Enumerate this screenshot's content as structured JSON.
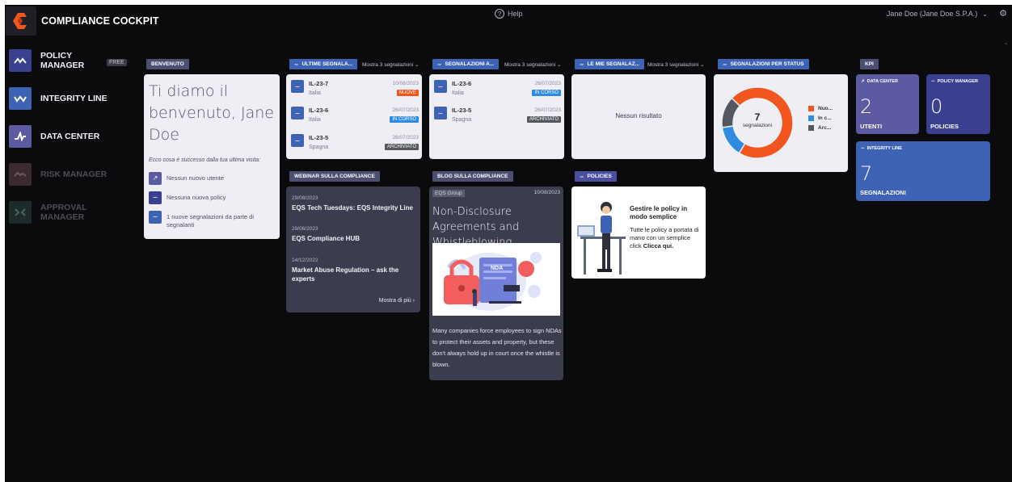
{
  "header": {
    "app_title": "COMPLIANCE COCKPIT",
    "help_label": "Help",
    "user_label": "Jane Doe (Jane Doe S.P.A.)"
  },
  "sidebar": {
    "items": [
      {
        "label_line1": "POLICY",
        "label_line2": "MANAGER",
        "badge": "FREE",
        "color": "#3b3f8f",
        "disabled": false
      },
      {
        "label_line1": "INTEGRITY LINE",
        "label_line2": "",
        "color": "#3f63b4",
        "disabled": false
      },
      {
        "label_line1": "DATA CENTER",
        "label_line2": "",
        "color": "#5c5aa0",
        "disabled": false
      },
      {
        "label_line1": "RISK MANAGER",
        "label_line2": "",
        "color": "#3a2a30",
        "disabled": true
      },
      {
        "label_line1": "APPROVAL",
        "label_line2": "MANAGER",
        "color": "#1d2c2b",
        "disabled": true
      }
    ]
  },
  "welcome": {
    "title": "BENVENUTO",
    "heading_l1": "Ti diamo il",
    "heading_l2": "benvenuto, Jane",
    "heading_l3": "Doe",
    "subtitle": "Ecco cosa è successo dalla tua ultima visita:",
    "items": [
      "Nessun nuovo utente",
      "Nessuna nuova policy",
      "1 nuove segnalazioni da parte di segnalanti"
    ]
  },
  "latest_reports": {
    "title": "ULTIME SEGNALA...",
    "more": "Mostra 3 segnalazioni",
    "rows": [
      {
        "id": "IL-23-7",
        "country": "Italia",
        "date": "10/08/2023",
        "status": "NUOVE",
        "status_color": "#f0561d"
      },
      {
        "id": "IL-23-6",
        "country": "Italia",
        "date": "26/07/2023",
        "status": "IN CORSO",
        "status_color": "#2f8be0"
      },
      {
        "id": "IL-23-5",
        "country": "Spagna",
        "date": "26/07/2023",
        "status": "ARCHIVIATO",
        "status_color": "#55575f"
      }
    ]
  },
  "assigned_reports": {
    "title": "SEGNALAZIONI A...",
    "more": "Mostra 3 segnalazioni",
    "rows": [
      {
        "id": "IL-23-6",
        "country": "Italia",
        "date": "26/07/2023",
        "status": "IN CORSO",
        "status_color": "#2f8be0"
      },
      {
        "id": "IL-23-5",
        "country": "Spagna",
        "date": "26/07/2023",
        "status": "ARCHIVIATO",
        "status_color": "#55575f"
      }
    ]
  },
  "my_reports": {
    "title": "LE MIE SEGNALAZ...",
    "more": "Mostra 3 segnalazioni",
    "empty": "Nessun risultato"
  },
  "status_chart": {
    "title": "SEGNALAZIONI PER STATUS",
    "total": "7",
    "total_label": "segnalazioni",
    "chart_data": {
      "type": "pie",
      "series": [
        {
          "name": "Nuo...",
          "value": 5,
          "color": "#f0561d"
        },
        {
          "name": "In c...",
          "value": 1,
          "color": "#2f8be0"
        },
        {
          "name": "Arc...",
          "value": 1,
          "color": "#55575f"
        }
      ]
    }
  },
  "kpi": {
    "title": "KPI",
    "tiles": [
      {
        "header": "DATA CENTER",
        "value": "2",
        "label": "UTENTI",
        "color": "#5c5aa0"
      },
      {
        "header": "POLICY MANAGER",
        "value": "0",
        "label": "POLICIES",
        "color": "#3b3f8f"
      },
      {
        "header": "INTEGRITY LINE",
        "value": "7",
        "label": "SEGNALAZIONI",
        "color": "#3f63b4"
      }
    ]
  },
  "webinar": {
    "title": "WEBINAR SULLA COMPLIANCE",
    "items": [
      {
        "date": "29/08/2023",
        "title": "EQS Tech Tuesdays: EQS Integrity Line"
      },
      {
        "date": "29/06/2023",
        "title": "EQS Compliance HUB"
      },
      {
        "date": "14/12/2022",
        "title": "Market Abuse Regulation – ask the experts"
      }
    ],
    "more": "Mostra di più"
  },
  "blog": {
    "title": "BLOG SULLA COMPLIANCE",
    "tag": "EQS Group",
    "date": "10/08/2023",
    "headline": "Non-Disclosure Agreements and Whistleblowing",
    "image_label": "NDA",
    "text": "Many companies force employees to sign NDAs to protect their assets and property, but these don't always hold up in court once the whistle is blown."
  },
  "policies": {
    "title": "POLICIES",
    "heading": "Gestire le policy in modo semplice",
    "text": "Tutte le policy a portata di mano con un semplice click",
    "link": "Clicca qui."
  }
}
